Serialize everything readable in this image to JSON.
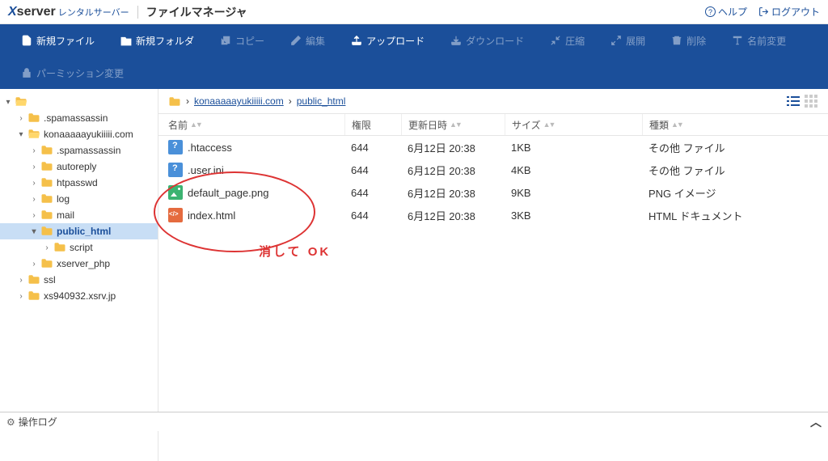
{
  "brand": {
    "x": "X",
    "server": "server",
    "rental": "レンタルサーバー",
    "app": "ファイルマネージャ"
  },
  "links": {
    "help": "ヘルプ",
    "logout": "ログアウト"
  },
  "toolbar": {
    "row1": [
      {
        "id": "new-file",
        "label": "新規ファイル",
        "enabled": true,
        "icon": "file-plus"
      },
      {
        "id": "new-folder",
        "label": "新規フォルダ",
        "enabled": true,
        "icon": "folder-plus"
      },
      {
        "id": "copy",
        "label": "コピー",
        "enabled": false,
        "icon": "copy"
      },
      {
        "id": "edit",
        "label": "編集",
        "enabled": false,
        "icon": "pencil"
      },
      {
        "id": "upload",
        "label": "アップロード",
        "enabled": true,
        "icon": "upload"
      },
      {
        "id": "download",
        "label": "ダウンロード",
        "enabled": false,
        "icon": "download"
      },
      {
        "id": "compress",
        "label": "圧縮",
        "enabled": false,
        "icon": "compress"
      },
      {
        "id": "expand",
        "label": "展開",
        "enabled": false,
        "icon": "expand"
      },
      {
        "id": "delete",
        "label": "削除",
        "enabled": false,
        "icon": "trash"
      },
      {
        "id": "rename",
        "label": "名前変更",
        "enabled": false,
        "icon": "rename"
      }
    ],
    "row2": [
      {
        "id": "permission",
        "label": "パーミッション変更",
        "enabled": false,
        "icon": "lock"
      }
    ]
  },
  "tree": [
    {
      "indent": 0,
      "chev": "▾",
      "label": "",
      "open": true
    },
    {
      "indent": 1,
      "chev": "›",
      "label": ".spamassassin"
    },
    {
      "indent": 1,
      "chev": "▾",
      "label": "konaaaaayukiiiii.com",
      "open": true
    },
    {
      "indent": 2,
      "chev": "›",
      "label": ".spamassassin"
    },
    {
      "indent": 2,
      "chev": "›",
      "label": "autoreply"
    },
    {
      "indent": 2,
      "chev": "›",
      "label": "htpasswd"
    },
    {
      "indent": 2,
      "chev": "›",
      "label": "log"
    },
    {
      "indent": 2,
      "chev": "›",
      "label": "mail"
    },
    {
      "indent": 2,
      "chev": "▾",
      "label": "public_html",
      "selected": true
    },
    {
      "indent": 3,
      "chev": "›",
      "label": "script"
    },
    {
      "indent": 2,
      "chev": "›",
      "label": "xserver_php"
    },
    {
      "indent": 1,
      "chev": "›",
      "label": "ssl"
    },
    {
      "indent": 1,
      "chev": "›",
      "label": "xs940932.xsrv.jp"
    }
  ],
  "breadcrumb": [
    "konaaaaayukiiiii.com",
    "public_html"
  ],
  "columns": {
    "name": "名前",
    "perm": "権限",
    "date": "更新日時",
    "size": "サイズ",
    "type": "種類"
  },
  "files": [
    {
      "icon": "ic-unknown",
      "name": ".htaccess",
      "perm": "644",
      "date": "6月12日 20:38",
      "size": "1KB",
      "type": "その他 ファイル"
    },
    {
      "icon": "ic-unknown",
      "name": ".user.ini",
      "perm": "644",
      "date": "6月12日 20:38",
      "size": "4KB",
      "type": "その他 ファイル"
    },
    {
      "icon": "ic-img",
      "name": "default_page.png",
      "perm": "644",
      "date": "6月12日 20:38",
      "size": "9KB",
      "type": "PNG イメージ"
    },
    {
      "icon": "ic-html",
      "name": "index.html",
      "perm": "644",
      "date": "6月12日 20:38",
      "size": "3KB",
      "type": "HTML ドキュメント"
    }
  ],
  "annotation": "消して OK",
  "status": "操作ログ"
}
